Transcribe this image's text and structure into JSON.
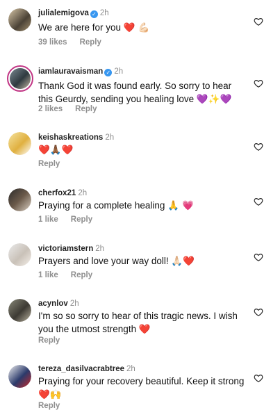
{
  "comments": [
    {
      "username": "julialemigova",
      "verified": true,
      "time": "2h",
      "text": "We are here for you",
      "emoji": "❤️ 💪🏻",
      "likes": "39 likes",
      "reply": "Reply"
    },
    {
      "username": "iamlauravaisman",
      "verified": true,
      "time": "2h",
      "text": "Thank God it was found early. So sorry to hear this Geurdy, sending you healing love",
      "emoji": "💜✨💜",
      "likes": "2 likes",
      "reply": "Reply"
    },
    {
      "username": "keishaskreations",
      "verified": false,
      "time": "2h",
      "text": "",
      "emoji": "❤️🙏🏾❤️",
      "likes": "",
      "reply": "Reply"
    },
    {
      "username": "cherfox21",
      "verified": false,
      "time": "2h",
      "text": "Praying for a complete healing",
      "emoji": "🙏 💗",
      "likes": "1 like",
      "reply": "Reply"
    },
    {
      "username": "victoriamstern",
      "verified": false,
      "time": "2h",
      "text": "Prayers and love your way doll!",
      "emoji": "🙏🏻❤️",
      "likes": "1 like",
      "reply": "Reply"
    },
    {
      "username": "acynlov",
      "verified": false,
      "time": "2h",
      "text": "I'm so so sorry to hear of this tragic news. I wish you the utmost strength",
      "emoji": "❤️",
      "likes": "",
      "reply": "Reply"
    },
    {
      "username": "tereza_dasilvacrabtree",
      "verified": false,
      "time": "2h",
      "text": "Praying for your recovery beautiful.  Keep it strong",
      "emoji": "❤️🙌",
      "likes": "",
      "reply": "Reply"
    }
  ],
  "colors": {
    "heart_outline": "#262626",
    "muted": "#8e8e8e",
    "verified": "#3897f0"
  }
}
